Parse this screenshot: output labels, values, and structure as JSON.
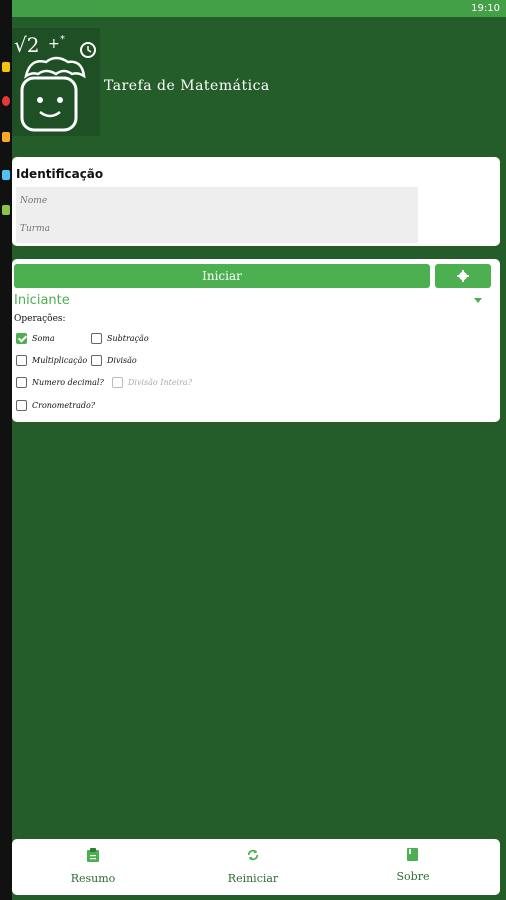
{
  "status_bar": {
    "time": "19:10"
  },
  "app": {
    "title": "Tarefa de Matemática"
  },
  "identification": {
    "heading": "Identificação",
    "name_placeholder": "Nome",
    "class_placeholder": "Turma"
  },
  "controls": {
    "start_label": "Iniciar",
    "level": "Iniciante",
    "operations_label": "Operações:"
  },
  "options": [
    {
      "label": "Soma",
      "checked": true
    },
    {
      "label": "Subtração",
      "checked": false
    },
    {
      "label": "Multiplicação",
      "checked": false
    },
    {
      "label": "Divisão",
      "checked": false
    },
    {
      "label": "Numero decimal?",
      "checked": false
    },
    {
      "label": "Divisão Inteira?",
      "checked": false,
      "disabled": true
    },
    {
      "label": "Cronometrado?",
      "checked": false
    }
  ],
  "bottom_nav": [
    {
      "label": "Resumo",
      "icon": "clipboard-icon"
    },
    {
      "label": "Reiniciar",
      "icon": "refresh-icon"
    },
    {
      "label": "Sobre",
      "icon": "book-icon"
    }
  ],
  "colors": {
    "primary": "#4caf50",
    "background": "#255d2a",
    "status_bar": "#43a047"
  }
}
